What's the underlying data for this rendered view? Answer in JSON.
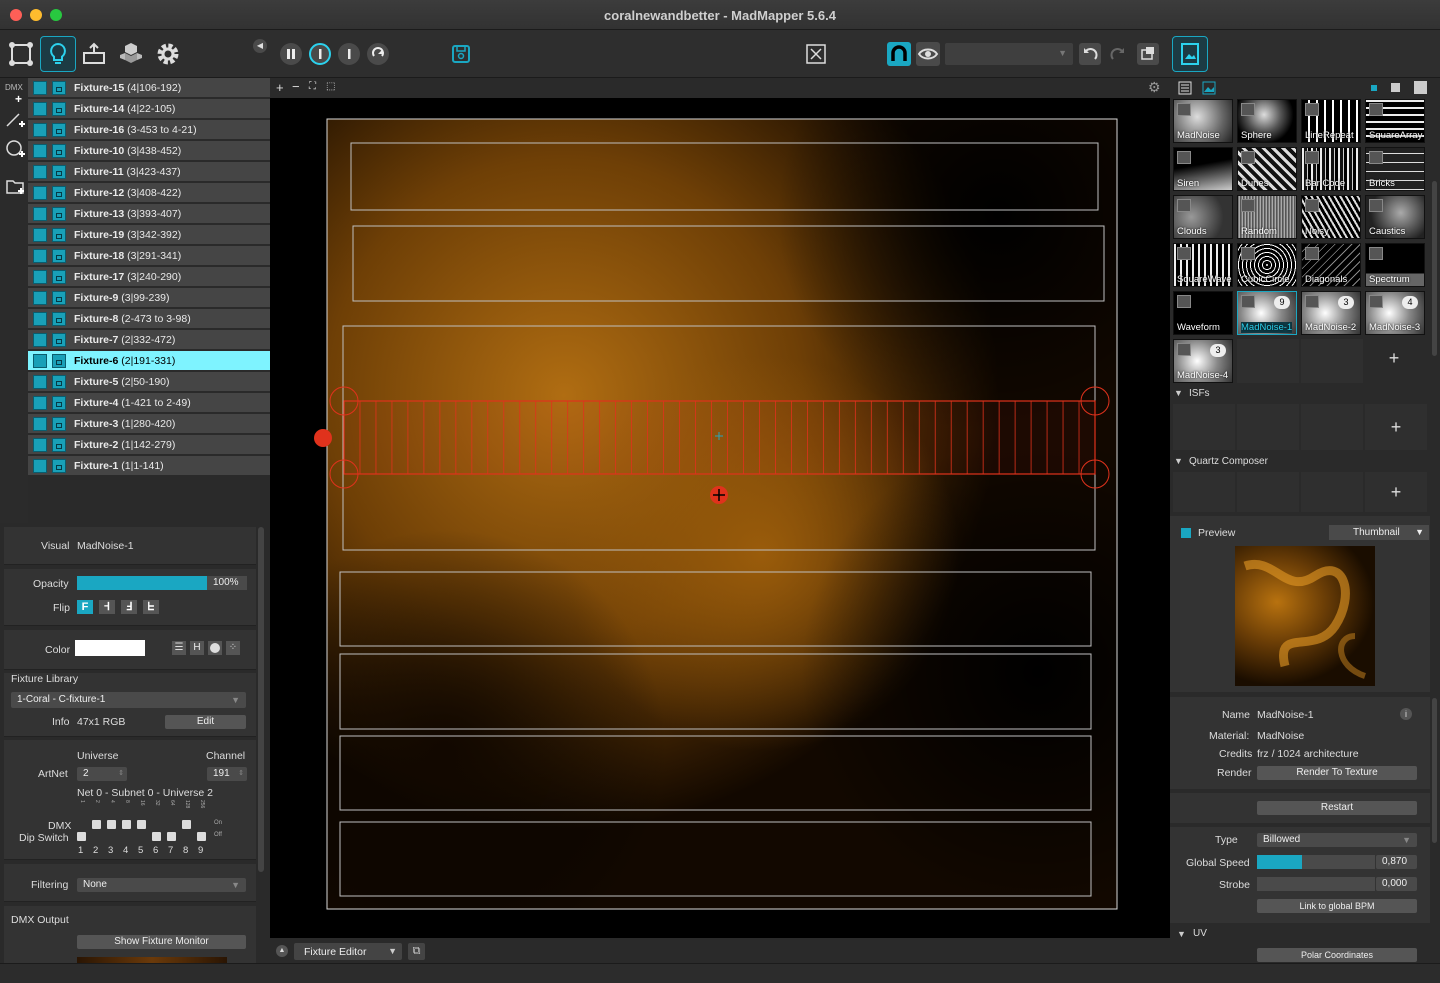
{
  "window": {
    "title": "coralnewandbetter - MadMapper 5.6.4"
  },
  "toolbar": {
    "colors": {
      "accent": "#1aa7c2"
    },
    "view_selector_value": ""
  },
  "tools": {
    "dmx_label": "DMX"
  },
  "fixtures": [
    {
      "name": "Fixture-15",
      "range": "(4|106-192)"
    },
    {
      "name": "Fixture-14",
      "range": "(4|22-105)"
    },
    {
      "name": "Fixture-16",
      "range": "(3-453 to 4-21)"
    },
    {
      "name": "Fixture-10",
      "range": "(3|438-452)"
    },
    {
      "name": "Fixture-11",
      "range": "(3|423-437)"
    },
    {
      "name": "Fixture-12",
      "range": "(3|408-422)"
    },
    {
      "name": "Fixture-13",
      "range": "(3|393-407)"
    },
    {
      "name": "Fixture-19",
      "range": "(3|342-392)"
    },
    {
      "name": "Fixture-18",
      "range": "(3|291-341)"
    },
    {
      "name": "Fixture-17",
      "range": "(3|240-290)"
    },
    {
      "name": "Fixture-9",
      "range": "(3|99-239)"
    },
    {
      "name": "Fixture-8",
      "range": "(2-473 to 3-98)"
    },
    {
      "name": "Fixture-7",
      "range": "(2|332-472)"
    },
    {
      "name": "Fixture-6",
      "range": "(2|191-331)",
      "selected": true
    },
    {
      "name": "Fixture-5",
      "range": "(2|50-190)"
    },
    {
      "name": "Fixture-4",
      "range": "(1-421 to 2-49)"
    },
    {
      "name": "Fixture-3",
      "range": "(1|280-420)"
    },
    {
      "name": "Fixture-2",
      "range": "(1|142-279)"
    },
    {
      "name": "Fixture-1",
      "range": "(1|1-141)"
    }
  ],
  "props": {
    "visual_label": "Visual",
    "visual_value": "MadNoise-1",
    "opacity_label": "Opacity",
    "opacity_value": "100%",
    "opacity_level": 1.0,
    "flip_label": "Flip",
    "flip_options": [
      "F",
      "Ꟶ",
      "Ⅎ",
      "ᖶ"
    ],
    "color_label": "Color",
    "color_value": "#ffffff",
    "color_mode_h": "H",
    "fixture_library_label": "Fixture Library",
    "fixture_library_value": "1-Coral - C-fixture-1",
    "info_label": "Info",
    "info_value": "47x1 RGB",
    "edit_label": "Edit",
    "universe_label": "Universe",
    "channel_label": "Channel",
    "artnet_label": "ArtNet",
    "universe_value": "2",
    "channel_value": "191",
    "net_text": "Net 0 - Subnet 0 - Universe 2",
    "dmx_label": "DMX",
    "dip_label": "Dip Switch",
    "dip_numbers": [
      "1",
      "2",
      "3",
      "4",
      "5",
      "6",
      "7",
      "8",
      "9"
    ],
    "dip_on": "On",
    "dip_off": "Off",
    "filtering_label": "Filtering",
    "filtering_value": "None",
    "dmx_output_label": "DMX Output",
    "show_monitor_label": "Show Fixture Monitor"
  },
  "canvas": {
    "footer_mode": "Fixture Editor",
    "fixture_accent": "#e0321c"
  },
  "materials": {
    "items": [
      {
        "name": "MadNoise"
      },
      {
        "name": "Sphere"
      },
      {
        "name": "LineRepeat"
      },
      {
        "name": "SquareArray"
      },
      {
        "name": "Siren"
      },
      {
        "name": "Dunes"
      },
      {
        "name": "Bar Code"
      },
      {
        "name": "Bricks"
      },
      {
        "name": "Clouds"
      },
      {
        "name": "Random"
      },
      {
        "name": "Noisy"
      },
      {
        "name": "Caustics"
      },
      {
        "name": "SquareWave"
      },
      {
        "name": "CubicCircle"
      },
      {
        "name": "Diagonals"
      },
      {
        "name": "Spectrum"
      },
      {
        "name": "Waveform"
      },
      {
        "name": "MadNoise-1",
        "count": "9",
        "selected": true
      },
      {
        "name": "MadNoise-2",
        "count": "3"
      },
      {
        "name": "MadNoise-3",
        "count": "4"
      },
      {
        "name": "MadNoise-4",
        "count": "3"
      }
    ],
    "isfs_label": "ISFs",
    "quartz_label": "Quartz Composer",
    "add_symbol": "+"
  },
  "preview": {
    "label": "Preview",
    "mode": "Thumbnail"
  },
  "material_info": {
    "name_label": "Name",
    "name_value": "MadNoise-1",
    "material_label": "Material:",
    "material_value": "MadNoise",
    "credits_label": "Credits",
    "credits_value": "frz / 1024 architecture",
    "render_label": "Render",
    "render_button": "Render  To Texture",
    "restart_button": "Restart",
    "type_label": "Type",
    "type_value": "Billowed",
    "speed_label": "Global Speed",
    "speed_value": "0,870",
    "speed_level": 0.87,
    "strobe_label": "Strobe",
    "strobe_value": "0,000",
    "strobe_level": 0.0,
    "bpm_button": "Link to global BPM",
    "uv_label": "UV",
    "polar_button": "Polar Coordinates"
  }
}
